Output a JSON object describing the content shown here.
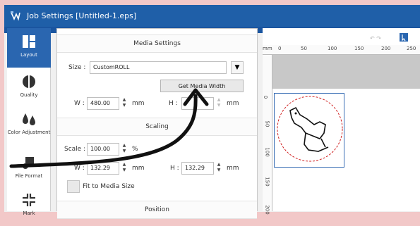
{
  "window": {
    "title": "Job Settings [Untitled-1.eps]"
  },
  "sidebar": {
    "items": [
      {
        "label": "Layout",
        "icon": "layout-icon",
        "active": true
      },
      {
        "label": "Quality",
        "icon": "quality-icon",
        "active": false
      },
      {
        "label": "Color Adjustment",
        "icon": "color-adjustment-icon",
        "active": false
      },
      {
        "label": "File Format",
        "icon": "file-format-icon",
        "active": false
      },
      {
        "label": "Mark",
        "icon": "mark-icon",
        "active": false
      }
    ]
  },
  "media_settings": {
    "header": "Media Settings",
    "size_label": "Size :",
    "size_value": "CustomROLL",
    "get_media_width_label": "Get Media Width",
    "w_label": "W :",
    "w_value": "480.00",
    "w_unit": "mm",
    "h_label": "H :",
    "h_unit": "mm"
  },
  "scaling": {
    "header": "Scaling",
    "scale_label": "Scale :",
    "scale_value": "100.00",
    "scale_unit": "%",
    "w_label": "W :",
    "w_value": "132.29",
    "w_unit": "mm",
    "h_label": "H :",
    "h_value": "132.29",
    "h_unit": "mm",
    "fit_label": "Fit to Media Size"
  },
  "position": {
    "header": "Position"
  },
  "preview": {
    "ruler_unit": "mm",
    "h_ticks": [
      "0",
      "50",
      "100",
      "150",
      "200",
      "250"
    ],
    "v_ticks": [
      "0",
      "50",
      "100",
      "150",
      "200"
    ]
  }
}
